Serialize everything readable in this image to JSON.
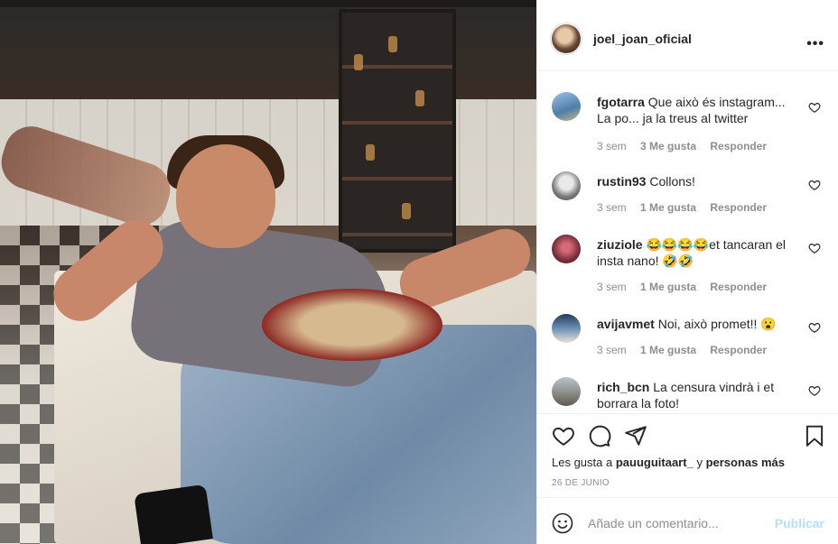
{
  "post": {
    "username": "joel_joan_oficial",
    "more_label": "•••"
  },
  "comments": [
    {
      "user": "fgotarra",
      "text": "Que això és instagram... La po... ja la treus al twitter",
      "age": "3 sem",
      "likes": "3 Me gusta",
      "reply": "Responder",
      "avatar_color": "#6a8fb0"
    },
    {
      "user": "rustin93",
      "text": "Collons!",
      "age": "3 sem",
      "likes": "1 Me gusta",
      "reply": "Responder",
      "avatar_color": "#9a9a9a"
    },
    {
      "user": "ziuziole",
      "text": "😂😂😂😂et tancaran el insta nano! 🤣🤣",
      "age": "3 sem",
      "likes": "1 Me gusta",
      "reply": "Responder",
      "avatar_color": "#7a2e3c"
    },
    {
      "user": "avijavmet",
      "text": "Noi, això promet!! 😮",
      "age": "3 sem",
      "likes": "1 Me gusta",
      "reply": "Responder",
      "avatar_color": "#3e5a7a"
    },
    {
      "user": "rich_bcn",
      "text": "La censura vindrà i et borrara la foto!",
      "age": "",
      "likes": "",
      "reply": "",
      "avatar_color": "#8c8c86"
    }
  ],
  "likes": {
    "prefix": "Les gusta a",
    "user": "pauuguitaart_",
    "middle": "y",
    "others": "personas más"
  },
  "date": "26 DE JUNIO",
  "add_comment": {
    "placeholder": "Añade un comentario...",
    "publish": "Publicar"
  },
  "icons": {
    "like": "heart-icon",
    "comment": "comment-icon",
    "share": "share-icon",
    "save": "bookmark-icon",
    "emoji": "smiley-icon",
    "more": "more-icon"
  }
}
